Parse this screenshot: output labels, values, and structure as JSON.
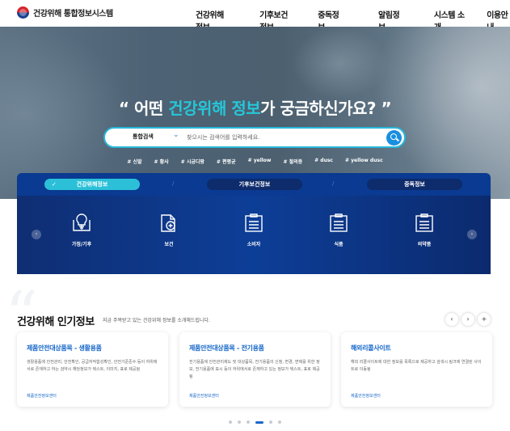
{
  "header": {
    "logo_text": "건강위해 통합정보시스템",
    "nav": [
      "건강위해정보",
      "기후보건정보",
      "중독정보",
      "알림정보",
      "시스템 소개",
      "이용안내"
    ]
  },
  "hero": {
    "headline_pre": "“ 어떤 ",
    "headline_hl": "건강위해 정보",
    "headline_post": "가 궁금하신가요? ”",
    "search_select": "통합검색",
    "search_placeholder": "찾으시는 검색어를 입력하세요.",
    "tags": [
      "# 신발",
      "# 황사",
      "# 시금디팡",
      "# 편평균",
      "# yellow",
      "# 절의증",
      "# dusc",
      "# yellow dusc"
    ]
  },
  "tabs": [
    "건강위해정보",
    "기후보건정보",
    "중독정보"
  ],
  "categories": [
    {
      "label": "가정/기후",
      "icon": "lightbulb-book-icon"
    },
    {
      "label": "보건",
      "icon": "medical-folder-icon"
    },
    {
      "label": "소비자",
      "icon": "consumer-board-icon"
    },
    {
      "label": "식품",
      "icon": "food-board-icon"
    },
    {
      "label": "의약품",
      "icon": "medicine-board-icon"
    }
  ],
  "popular": {
    "title": "건강위해 인기정보",
    "subtitle": "지금 주목받고 있는 건강위해 정보를 소개해드립니다.",
    "controls": [
      "‹",
      "›",
      "+"
    ],
    "cards": [
      {
        "title": "제품안전대상품목 - 생활용품",
        "desc": "생활용품에 안전관리, 안전확인, 공급자적합성확인, 안전기준준수 등이 하위에서로 존재하고 하는 검약시 해당정보가 텍스트, 이미지, 표로 제공됨",
        "link": "제품안전정보센터"
      },
      {
        "title": "제품안전대상품목 - 전기용품",
        "desc": "전기용품에 안전관리제도 및 대상품목, 전기용품의 신청, 변경, 면제를 위한 정보, 전기용품에 표시 등이 하위에서로 존재하고 있는 정보가 텍스트, 표로 제공됨",
        "link": "제품안전정보센터"
      },
      {
        "title": "해외리콜사이트",
        "desc": "해외 리콜사이트에 대한 정보를 목록으로 제공하고 검색시 링크에 연결된 사이트로 이동됨",
        "link": "제품안전정보센터"
      }
    ],
    "pagination_dots": 6,
    "pagination_active": 4
  },
  "colors": {
    "accent": "#25c7d9",
    "brand_navy": "#0a3a91",
    "link_blue": "#1667c9"
  }
}
